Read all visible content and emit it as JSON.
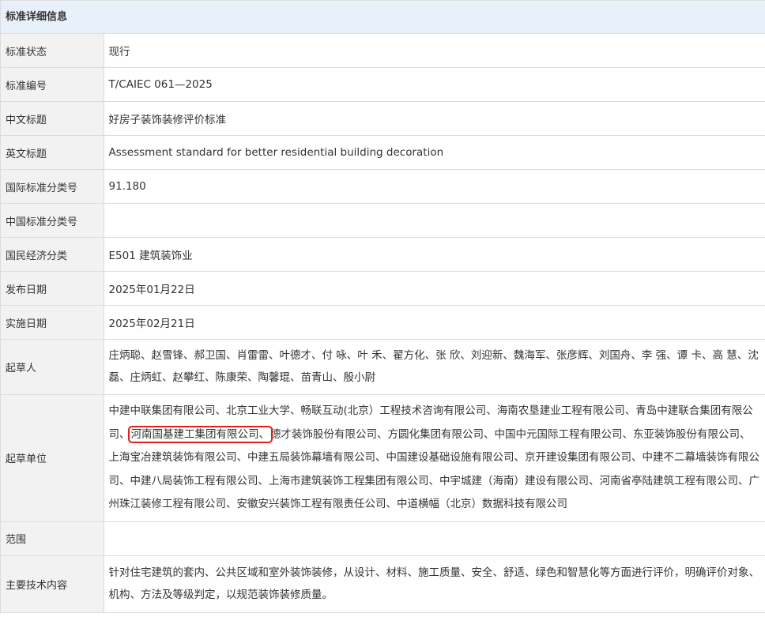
{
  "panel": {
    "title": "标准详细信息"
  },
  "rows": {
    "status": {
      "label": "标准状态",
      "value": "现行"
    },
    "number": {
      "label": "标准编号",
      "value": "T/CAIEC 061—2025"
    },
    "cn_title": {
      "label": "中文标题",
      "value": "好房子装饰装修评价标准"
    },
    "en_title": {
      "label": "英文标题",
      "value": "Assessment standard for better residential building decoration"
    },
    "ics": {
      "label": "国际标准分类号",
      "value": "91.180"
    },
    "ccs": {
      "label": "中国标准分类号",
      "value": ""
    },
    "economy": {
      "label": "国民经济分类",
      "value": "E501 建筑装饰业"
    },
    "publish_date": {
      "label": "发布日期",
      "value": "2025年01月22日"
    },
    "effective_date": {
      "label": "实施日期",
      "value": "2025年02月21日"
    },
    "drafters": {
      "label": "起草人",
      "value": "庄炳聪、赵雪锋、郝卫国、肖雷雷、叶德才、付 咏、叶 禾、翟方化、张 欣、刘迎新、魏海军、张彦辉、刘国舟、李 强、谭 卡、高 慧、沈 磊、庄炳虹、赵攀红、陈康荣、陶馨琨、苗青山、殷小尉"
    },
    "units": {
      "label": "起草单位",
      "part1": "中建中联集团有限公司、北京工业大学、畅联互动(北京）工程技术咨询有限公司、海南农垦建业工程有限公司、青岛中建联合集团有限公司、",
      "highlighted": "河南国基建工集团有限公司、",
      "part2": "德才装饰股份有限公司、方圆化集团有限公司、中国中元国际工程有限公司、东亚装饰股份有限公司、上海宝冶建筑装饰有限公司、中建五局装饰幕墙有限公司、中国建设基础设施有限公司、京开建设集团有限公司、中建不二幕墙装饰有限公司、中建八局装饰工程有限公司、上海市建筑装饰工程集团有限公司、中宇城建（海南）建设有限公司、河南省亭陆建筑工程有限公司、广州珠江装修工程有限公司、安徽安兴装饰工程有限责任公司、中道横幅（北京）数据科技有限公司"
    },
    "scope": {
      "label": "范围",
      "value": ""
    },
    "tech": {
      "label": "主要技术内容",
      "value": "针对住宅建筑的套内、公共区域和室外装饰装修，从设计、材料、施工质量、安全、舒适、绿色和智慧化等方面进行评价，明确评价对象、机构、方法及等级判定，以规范装饰装修质量。"
    }
  },
  "colors": {
    "header_bg": "#e8f0fa",
    "label_bg": "#f2f2f2",
    "border": "#dcdcdc",
    "highlight": "#e0201c"
  }
}
